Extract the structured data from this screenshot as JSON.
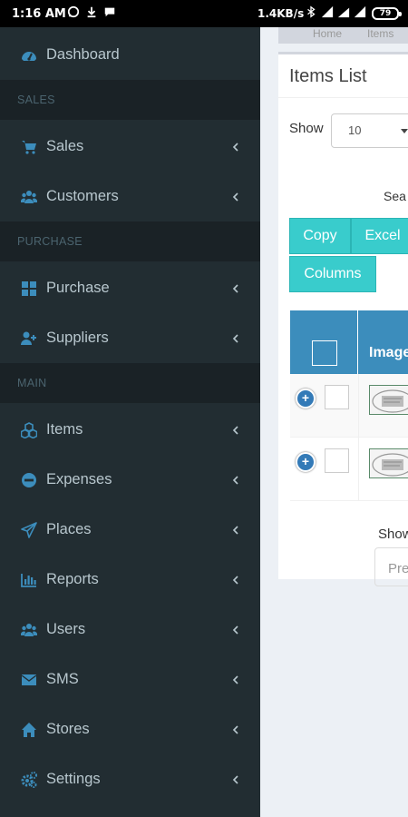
{
  "status_bar": {
    "time": "1:16 AM",
    "net_speed": "1.4KB/s",
    "battery": "79"
  },
  "sidebar": {
    "items": [
      {
        "label": "Dashboard",
        "icon": "dashboard-icon"
      },
      {
        "header": "SALES"
      },
      {
        "label": "Sales",
        "icon": "cart-icon"
      },
      {
        "label": "Customers",
        "icon": "users-icon"
      },
      {
        "header": "PURCHASE"
      },
      {
        "label": "Purchase",
        "icon": "grid-icon"
      },
      {
        "label": "Suppliers",
        "icon": "user-plus-icon"
      },
      {
        "header": "MAIN"
      },
      {
        "label": "Items",
        "icon": "cubes-icon"
      },
      {
        "label": "Expenses",
        "icon": "minus-circle-icon"
      },
      {
        "label": "Places",
        "icon": "paper-plane-icon"
      },
      {
        "label": "Reports",
        "icon": "bar-chart-icon"
      },
      {
        "label": "Users",
        "icon": "users-icon"
      },
      {
        "label": "SMS",
        "icon": "envelope-icon"
      },
      {
        "label": "Stores",
        "icon": "home-icon"
      },
      {
        "label": "Settings",
        "icon": "cogs-icon"
      }
    ]
  },
  "breadcrumb": {
    "home": "Home",
    "current": "Items"
  },
  "items_list": {
    "title": "Items List",
    "show_label": "Show",
    "page_length": "10",
    "search_label": "Sea",
    "buttons": [
      "Copy",
      "Excel",
      "Columns"
    ],
    "column_image": "Image",
    "footer_show": "Show",
    "prev_label": "Pre"
  },
  "colors": {
    "sidebar_bg": "#222d32",
    "sidebar_header_bg": "#1a2226",
    "accent_blue": "#3c8dbc",
    "teal_button": "#39cccc",
    "icon_blue": "#3c8dbc"
  }
}
